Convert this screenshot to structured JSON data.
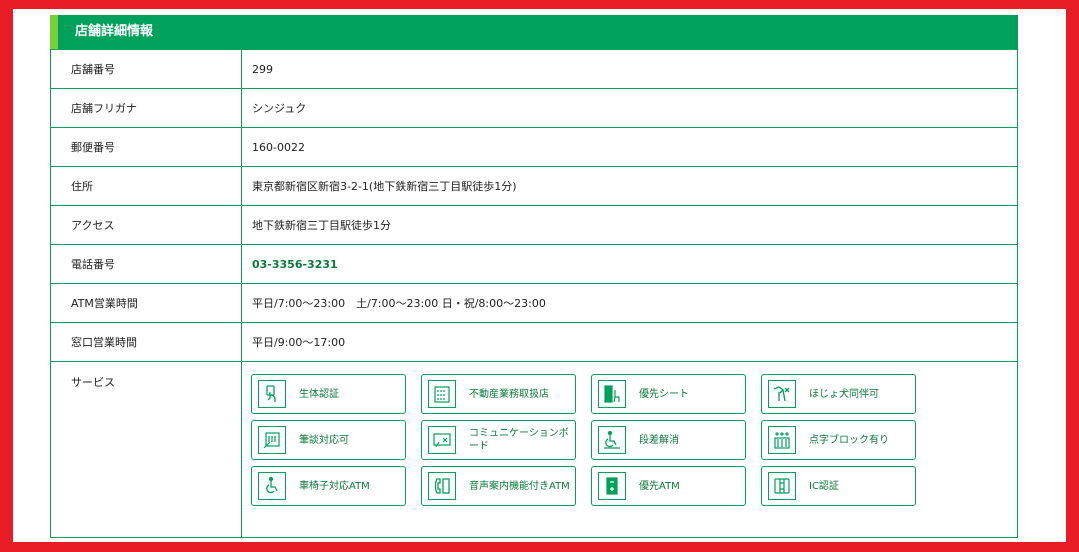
{
  "header": {
    "title": "店舗詳細情報"
  },
  "rows": [
    {
      "label": "店舗番号",
      "value": "299"
    },
    {
      "label": "店舗フリガナ",
      "value": "シンジュク"
    },
    {
      "label": "郵便番号",
      "value": "160-0022"
    },
    {
      "label": "住所",
      "value": "東京都新宿区新宿3-2-1(地下鉄新宿三丁目駅徒歩1分)"
    },
    {
      "label": "アクセス",
      "value": "地下鉄新宿三丁目駅徒歩1分"
    },
    {
      "label": "電話番号",
      "value": "03-3356-3231"
    },
    {
      "label": "ATM営業時間",
      "value": "平日/7:00～23:00　土/7:00～23:00 日・祝/8:00～23:00"
    },
    {
      "label": "窓口営業時間",
      "value": "平日/9:00～17:00"
    }
  ],
  "services": {
    "label": "サービス",
    "items": [
      {
        "label": "生体認証",
        "icon": "biometric-icon"
      },
      {
        "label": "不動産業務取扱店",
        "icon": "building-icon"
      },
      {
        "label": "優先シート",
        "icon": "priority-seat-icon"
      },
      {
        "label": "ほじょ犬同伴可",
        "icon": "assistance-dog-icon"
      },
      {
        "label": "筆談対応可",
        "icon": "writing-board-icon"
      },
      {
        "label": "コミュニケーションボード",
        "icon": "communication-board-icon"
      },
      {
        "label": "段差解消",
        "icon": "step-free-icon"
      },
      {
        "label": "点字ブロック有り",
        "icon": "braille-block-icon"
      },
      {
        "label": "車椅子対応ATM",
        "icon": "wheelchair-icon"
      },
      {
        "label": "音声案内機能付きATM",
        "icon": "voice-guide-icon"
      },
      {
        "label": "優先ATM",
        "icon": "priority-atm-icon"
      },
      {
        "label": "IC認証",
        "icon": "ic-card-icon"
      }
    ]
  },
  "colors": {
    "accent": "#00a15a",
    "accent_light": "#7ccf3a",
    "frame": "#e81c24",
    "link": "#0b7a3b"
  }
}
